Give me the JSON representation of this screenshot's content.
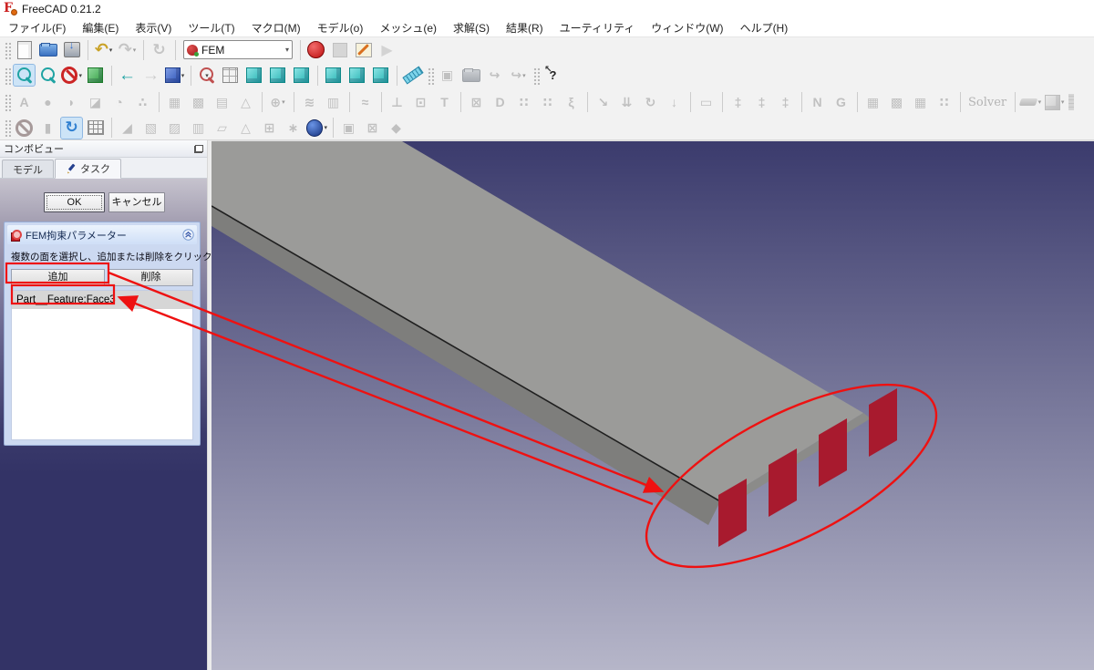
{
  "window": {
    "title": "FreeCAD 0.21.2"
  },
  "menubar": [
    "ファイル(F)",
    "編集(E)",
    "表示(V)",
    "ツール(T)",
    "マクロ(M)",
    "モデル(o)",
    "メッシュ(e)",
    "求解(S)",
    "結果(R)",
    "ユーティリティ",
    "ウィンドウ(W)",
    "ヘルプ(H)"
  ],
  "workbench_selector": {
    "value": "FEM"
  },
  "toolbars": [
    {
      "name": "toolbar-file",
      "items": [
        {
          "t": "grip"
        },
        {
          "n": "new-file-icon",
          "k": "doc"
        },
        {
          "n": "open-file-icon",
          "k": "folder"
        },
        {
          "n": "save-icon",
          "k": "save"
        },
        {
          "t": "sep"
        },
        {
          "n": "undo-icon",
          "k": "undo",
          "g": "↶",
          "dd": 1
        },
        {
          "n": "redo-icon",
          "k": "redo",
          "g": "↷",
          "dd": 1,
          "dis": 1
        },
        {
          "t": "sep"
        },
        {
          "n": "refresh-icon",
          "k": "refresh",
          "g": "↻",
          "dis": 1
        },
        {
          "t": "sep"
        },
        {
          "t": "combo"
        },
        {
          "t": "sep"
        },
        {
          "n": "macro-record-icon",
          "k": "record"
        },
        {
          "n": "macro-stop-icon",
          "k": "stop",
          "dis": 1
        },
        {
          "n": "macro-edit-icon",
          "k": "edit"
        },
        {
          "n": "macro-play-icon",
          "k": "play",
          "g": "▶",
          "dis": 1
        }
      ]
    },
    {
      "name": "toolbar-view",
      "items": [
        {
          "t": "grip"
        },
        {
          "n": "view-fit-all-icon",
          "k": "mag",
          "act": 1
        },
        {
          "n": "view-zoom-selection-icon",
          "k": "mag"
        },
        {
          "n": "draw-style-icon",
          "k": "noentry",
          "dd": 1
        },
        {
          "n": "view-isometric-icon",
          "k": "cubeG"
        },
        {
          "t": "sep"
        },
        {
          "n": "view-back-icon",
          "k": "arrowL",
          "g": "←"
        },
        {
          "n": "view-forward-icon",
          "k": "arrowR",
          "g": "→",
          "dis": 1
        },
        {
          "n": "view-axonometric-icon",
          "k": "cubeB",
          "dd": 1
        },
        {
          "t": "sep"
        },
        {
          "n": "zoom-tools-icon",
          "k": "magR",
          "dd": 1
        },
        {
          "n": "view-cube-wire-icon",
          "k": "cubeW"
        },
        {
          "n": "view-front-icon",
          "k": "cubeT"
        },
        {
          "n": "view-top-icon",
          "k": "cubeT"
        },
        {
          "n": "view-right-icon",
          "k": "cubeT"
        },
        {
          "t": "sep"
        },
        {
          "n": "view-rear-icon",
          "k": "cubeT"
        },
        {
          "n": "view-bottom-icon",
          "k": "cubeT"
        },
        {
          "n": "view-left-icon",
          "k": "cubeT"
        },
        {
          "t": "sep"
        },
        {
          "n": "measure-icon",
          "k": "ruler"
        },
        {
          "t": "grip"
        },
        {
          "n": "link-make-icon",
          "k": "gray",
          "g": "▣",
          "dis": 1
        },
        {
          "n": "link-folder-icon",
          "k": "folder",
          "dis": 1
        },
        {
          "n": "link-import-icon",
          "k": "gray",
          "g": "↪",
          "dis": 1
        },
        {
          "n": "link-import-all-icon",
          "k": "gray",
          "g": "↪",
          "dd": 1,
          "dis": 1
        },
        {
          "t": "grip"
        },
        {
          "n": "whats-this-icon",
          "k": "whats",
          "g": "?"
        }
      ]
    },
    {
      "name": "toolbar-fem",
      "items": [
        {
          "t": "grip"
        },
        {
          "n": "fem-analysis-icon",
          "k": "gray",
          "g": "A",
          "dis": 1
        },
        {
          "n": "fem-material-icon",
          "k": "gray",
          "g": "●",
          "dis": 1
        },
        {
          "n": "fem-material-fluid-icon",
          "k": "gray",
          "g": "◗",
          "dis": 1
        },
        {
          "n": "fem-clip-plane-icon",
          "k": "gray",
          "g": "◪",
          "dis": 1
        },
        {
          "n": "fem-clip-sphere-icon",
          "k": "gray",
          "g": "◔",
          "dis": 1
        },
        {
          "n": "fem-material-multiple-icon",
          "k": "gray",
          "g": "∴",
          "dis": 1
        },
        {
          "t": "sep"
        },
        {
          "n": "fem-mesh-box-icon",
          "k": "gray",
          "g": "▦",
          "dis": 1
        },
        {
          "n": "fem-mesh-shape-icon",
          "k": "gray",
          "g": "▩",
          "dis": 1
        },
        {
          "n": "fem-mesh-boundary-icon",
          "k": "gray",
          "g": "▤",
          "dis": 1
        },
        {
          "n": "fem-mesh-1d-icon",
          "k": "gray",
          "g": "△",
          "dis": 1
        },
        {
          "t": "sep"
        },
        {
          "n": "fem-constraint-group-icon",
          "k": "gray",
          "g": "⊕",
          "dd": 1,
          "dis": 1
        },
        {
          "t": "sep"
        },
        {
          "n": "fem-beam-section-icon",
          "k": "gray",
          "g": "≋",
          "dis": 1
        },
        {
          "n": "fem-shell-thickness-icon",
          "k": "gray",
          "g": "▥",
          "dis": 1
        },
        {
          "t": "sep"
        },
        {
          "n": "fem-fluid-section-icon",
          "k": "gray",
          "g": "≈",
          "dis": 1
        },
        {
          "t": "sep"
        },
        {
          "n": "fem-constraint-fixed-icon",
          "k": "gray",
          "g": "⊥",
          "dis": 1
        },
        {
          "n": "fem-constraint-rigid-icon",
          "k": "gray",
          "g": "⊡",
          "dis": 1
        },
        {
          "n": "fem-constraint-transform-icon",
          "k": "gray",
          "g": "T",
          "dis": 1
        },
        {
          "t": "sep"
        },
        {
          "n": "fem-constraint-lock-icon",
          "k": "gray",
          "g": "⊠",
          "dis": 1
        },
        {
          "n": "fem-constraint-displacement-icon",
          "k": "gray",
          "g": "D",
          "dis": 1
        },
        {
          "n": "fem-constraint-contact-icon",
          "k": "gray",
          "g": "∷",
          "dis": 1
        },
        {
          "n": "fem-constraint-tie-icon",
          "k": "gray",
          "g": "∷",
          "dis": 1
        },
        {
          "n": "fem-constraint-spring-icon",
          "k": "gray",
          "g": "ξ",
          "dis": 1
        },
        {
          "t": "sep"
        },
        {
          "n": "fem-load-force-icon",
          "k": "gray",
          "g": "↘",
          "dis": 1
        },
        {
          "n": "fem-load-pressure-icon",
          "k": "gray",
          "g": "⇊",
          "dis": 1
        },
        {
          "n": "fem-load-torque-icon",
          "k": "gray",
          "g": "↻",
          "dis": 1
        },
        {
          "n": "fem-load-gravity-icon",
          "k": "gray",
          "g": "↓",
          "dis": 1
        },
        {
          "t": "sep"
        },
        {
          "n": "fem-constraint-section-print-icon",
          "k": "gray",
          "g": "▭",
          "dis": 1
        },
        {
          "t": "sep"
        },
        {
          "n": "fem-thermal-temperature-icon",
          "k": "gray",
          "g": "‡",
          "dis": 1
        },
        {
          "n": "fem-thermal-heatflux-icon",
          "k": "gray",
          "g": "‡",
          "dis": 1
        },
        {
          "n": "fem-thermal-bodyheat-icon",
          "k": "gray",
          "g": "‡",
          "dis": 1
        },
        {
          "t": "sep"
        },
        {
          "n": "fem-mesh-netgen-icon",
          "k": "gray",
          "g": "N",
          "dis": 1
        },
        {
          "n": "fem-mesh-gmsh-icon",
          "k": "gray",
          "g": "G",
          "dis": 1
        },
        {
          "t": "sep"
        },
        {
          "n": "fem-mesh-region-icon",
          "k": "gray",
          "g": "▦",
          "dis": 1
        },
        {
          "n": "fem-mesh-group-icon",
          "k": "gray",
          "g": "▩",
          "dis": 1
        },
        {
          "n": "fem-mesh-boundary-layer-icon",
          "k": "gray",
          "g": "▦",
          "dis": 1
        },
        {
          "n": "fem-mesh-to-part-icon",
          "k": "gray",
          "g": "∷",
          "dis": 1
        },
        {
          "t": "sep"
        },
        {
          "n": "fem-solver-icon",
          "k": "solver",
          "g": "Solver",
          "dis": 1
        },
        {
          "t": "sep"
        },
        {
          "n": "fem-result-show-icon",
          "k": "colorbar",
          "dd": 1,
          "dis": 1
        },
        {
          "n": "fem-result-pipeline-icon",
          "k": "cubeGr",
          "dd": 1,
          "dis": 1
        },
        {
          "n": "fem-clipped-icon",
          "k": "clipped",
          "dis": 1
        }
      ]
    },
    {
      "name": "toolbar-post",
      "items": [
        {
          "t": "grip"
        },
        {
          "n": "post-clear-icon",
          "k": "noentry",
          "dis": 1
        },
        {
          "n": "post-display-icon",
          "k": "gray",
          "g": "▮",
          "dis": 1
        },
        {
          "n": "post-refresh-icon",
          "k": "refreshB",
          "g": "↻",
          "act": 1
        },
        {
          "n": "post-grid-icon",
          "k": "grid"
        },
        {
          "t": "sep"
        },
        {
          "n": "post-ramp-icon",
          "k": "gray",
          "g": "◢",
          "dis": 1
        },
        {
          "n": "post-scalar-icon",
          "k": "gray",
          "g": "▧",
          "dis": 1
        },
        {
          "n": "post-vector-icon",
          "k": "gray",
          "g": "▨",
          "dis": 1
        },
        {
          "n": "post-section-icon",
          "k": "gray",
          "g": "▥",
          "dis": 1
        },
        {
          "n": "post-surface-icon",
          "k": "gray",
          "g": "▱",
          "dis": 1
        },
        {
          "n": "post-triangulate-icon",
          "k": "gray",
          "g": "△",
          "dis": 1
        },
        {
          "n": "post-tools-icon",
          "k": "gray",
          "g": "⊞",
          "dis": 1
        },
        {
          "n": "post-snow-icon",
          "k": "gray",
          "g": "∗",
          "dis": 1
        },
        {
          "n": "post-sphere-icon",
          "k": "sphereB",
          "dd": 1
        },
        {
          "t": "sep"
        },
        {
          "n": "post-clip-box-icon",
          "k": "gray",
          "g": "▣",
          "dis": 1
        },
        {
          "n": "post-clip-remove-icon",
          "k": "gray",
          "g": "⊠",
          "dis": 1
        },
        {
          "n": "post-section-camera-icon",
          "k": "gray",
          "g": "◆",
          "dis": 1
        }
      ]
    }
  ],
  "combo_view": {
    "header": "コンボビュー",
    "tabs": [
      {
        "label": "モデル",
        "active": false
      },
      {
        "label": "タスク",
        "active": true
      }
    ],
    "task": {
      "ok_label": "OK",
      "cancel_label": "キャンセル",
      "fem_panel": {
        "title": "FEM拘束パラメーター",
        "instruction": "複数の面を選択し、追加または削除をクリック",
        "add_label": "追加",
        "remove_label": "削除",
        "items": [
          "Part__Feature:Face3"
        ]
      }
    }
  },
  "viewport": {
    "background_top": "#3b3b6d",
    "background_bottom": "#b6b6c9",
    "beam_top_color": "#9b9b99",
    "beam_side_color": "#7e7e7c",
    "beam_end_color": "#8b8b89",
    "beam_edge_color": "#1f1f1f",
    "constraint_face_color": "#a81a2e",
    "constraint_face_edge": "#6f0f1f",
    "annotation_color": "#ee1111"
  }
}
